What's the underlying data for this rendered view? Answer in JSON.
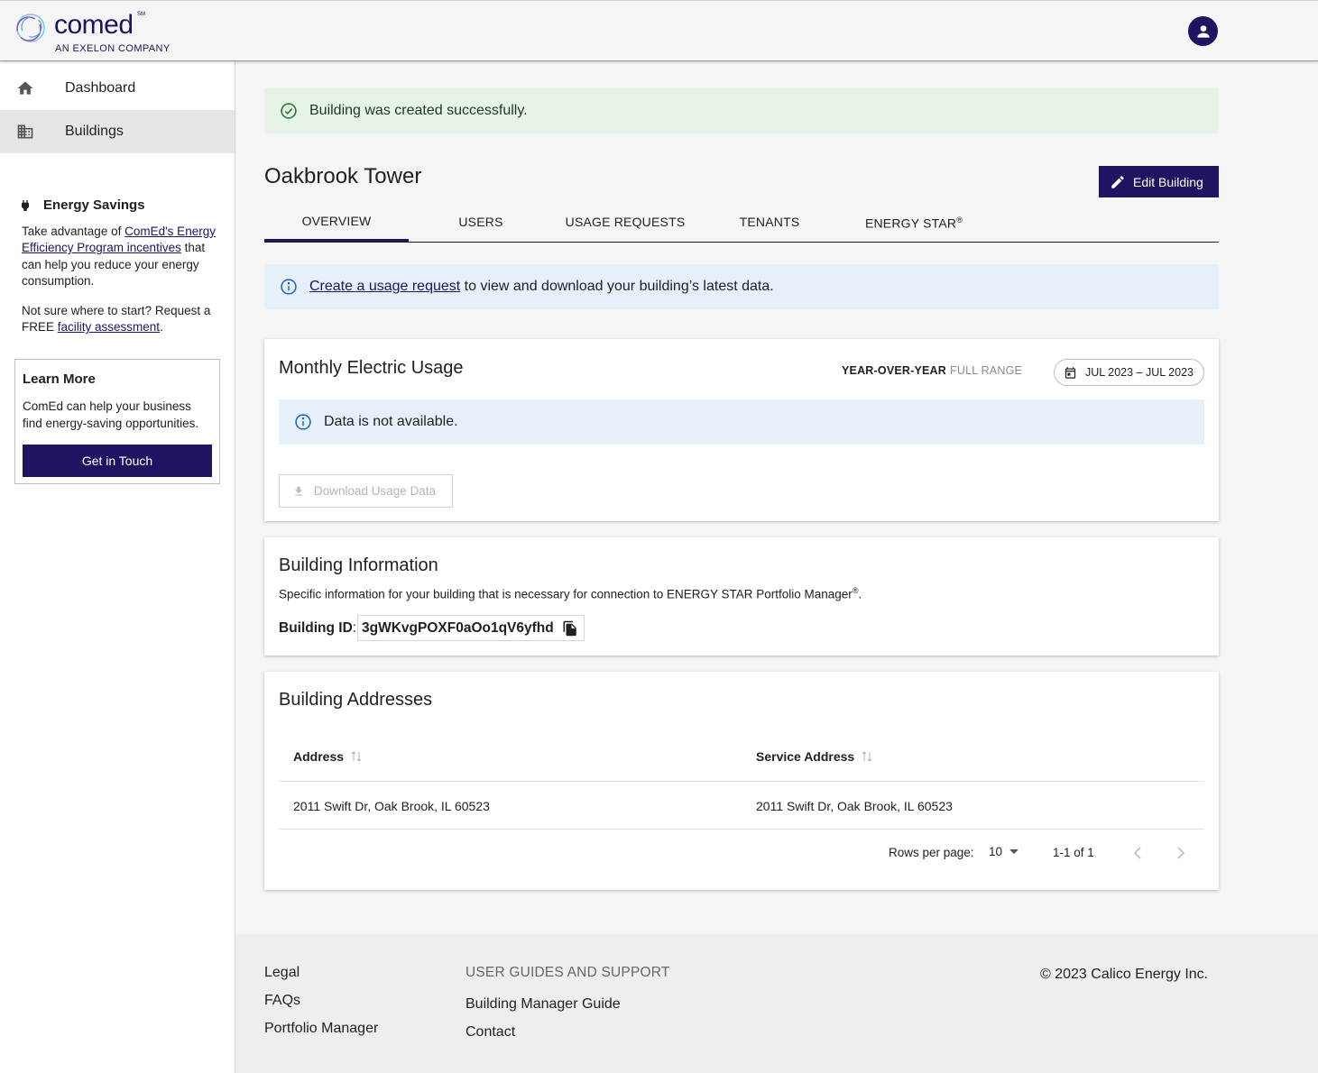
{
  "header": {
    "logo_word": "comed",
    "logo_sm": "SM",
    "logo_sub": "AN EXELON COMPANY"
  },
  "sidebar": {
    "items": [
      {
        "label": "Dashboard",
        "icon": "home-icon"
      },
      {
        "label": "Buildings",
        "icon": "building-icon",
        "active": true
      }
    ],
    "savings": {
      "title": "Energy Savings",
      "p1_a": "Take advantage of ",
      "p1_link": "ComEd's Energy Efficiency Program incentives",
      "p1_b": " that can help you reduce your energy consumption.",
      "p2_a": "Not sure where to start? Request a FREE ",
      "p2_link": "facility assessment",
      "p2_b": "."
    },
    "learn_more": {
      "title": "Learn More",
      "desc": "ComEd can help your business find energy-saving opportunities.",
      "button": "Get in Touch"
    }
  },
  "main": {
    "success_alert": "Building was created successfully.",
    "title": "Oakbrook Tower",
    "edit_button": "Edit Building",
    "tabs": [
      {
        "label": "OVERVIEW",
        "active": true
      },
      {
        "label": "USERS"
      },
      {
        "label": "USAGE REQUESTS"
      },
      {
        "label": "TENANTS"
      },
      {
        "label": "ENERGY STAR",
        "sup": "®"
      }
    ],
    "info_alert": {
      "link": "Create a usage request",
      "text": " to view and download your building’s latest data."
    }
  },
  "usage_card": {
    "title": "Monthly Electric Usage",
    "range_options": [
      "YEAR-OVER-YEAR",
      "FULL RANGE"
    ],
    "selected_range": "YEAR-OVER-YEAR",
    "date_range": "JUL 2023 – JUL 2023",
    "no_data": "Data is not available.",
    "download_button": "Download Usage Data"
  },
  "info_card": {
    "title": "Building Information",
    "desc": "Specific information for your building that is necessary for connection to ENERGY STAR Portfolio Manager",
    "desc_sup": "®",
    "desc_end": ".",
    "id_label": "Building ID",
    "id_colon": ":",
    "id_value": "3gWKvgPOXF0aOo1qV6yfhd"
  },
  "addresses_card": {
    "title": "Building Addresses",
    "columns": [
      "Address",
      "Service Address"
    ],
    "rows": [
      [
        "2011 Swift Dr, Oak Brook, IL 60523",
        "2011 Swift Dr, Oak Brook, IL 60523"
      ]
    ],
    "rows_per_page_label": "Rows per page:",
    "rows_per_page": "10",
    "page_info": "1-1 of 1"
  },
  "footer": {
    "col1": [
      "Legal",
      "FAQs",
      "Portfolio Manager"
    ],
    "col2_title": "USER GUIDES AND SUPPORT",
    "col2": [
      "Building Manager Guide",
      "Contact"
    ],
    "copyright": "© 2023 Calico Energy Inc."
  },
  "colors": {
    "brand": "#1e1462",
    "success_bg": "#e8f3e8",
    "info_bg": "#e6f0fb",
    "success_icon": "#2e7d32",
    "info_icon": "#1565c0"
  }
}
